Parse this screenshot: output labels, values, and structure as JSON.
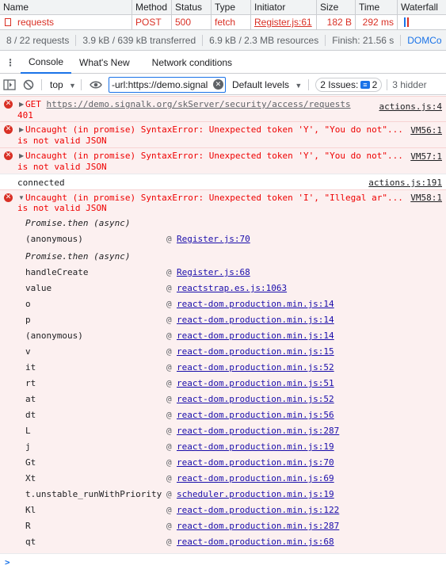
{
  "network": {
    "headers": [
      "Name",
      "Method",
      "Status",
      "Type",
      "Initiator",
      "Size",
      "Time",
      "Waterfall"
    ],
    "row": {
      "name": "requests",
      "method": "POST",
      "status": "500",
      "type": "fetch",
      "initiator": "Register.js:61",
      "size": "182 B",
      "time": "292 ms"
    },
    "summary": {
      "requests": "8 / 22 requests",
      "transferred": "3.9 kB / 639 kB transferred",
      "resources": "6.9 kB / 2.3 MB resources",
      "finish": "Finish: 21.56 s",
      "domcontent": "DOMCo"
    }
  },
  "drawer": {
    "tabs": [
      "Console",
      "What's New",
      "Network conditions"
    ],
    "active_tab": "Console"
  },
  "toolbar": {
    "context": "top",
    "filter_value": "-url:https://demo.signal",
    "levels": "Default levels",
    "issues_label": "2 Issues:",
    "issues_count": "2",
    "hidden": "3 hidder"
  },
  "console": {
    "msg1": {
      "method": "GET",
      "url": "https://demo.signalk.org/skServer/security/access/requests",
      "status": "401",
      "source": "actions.js:4"
    },
    "msg2": {
      "line1": "Uncaught (in promise) SyntaxError: Unexpected token 'Y', \"You do not\"...",
      "line2": "is not valid JSON",
      "source": "VM56:1"
    },
    "msg3": {
      "line1": "Uncaught (in promise) SyntaxError: Unexpected token 'Y', \"You do not\"...",
      "line2": "is not valid JSON",
      "source": "VM57:1"
    },
    "msg4": {
      "text": "connected",
      "source": "actions.js:191"
    },
    "msg5": {
      "line1": "Uncaught (in promise) SyntaxError: Unexpected token 'I', \"Illegal ar\"...",
      "line2": "is not valid JSON",
      "source": "VM58:1",
      "async1": "Promise.then (async)",
      "async2": "Promise.then (async)",
      "at": "@",
      "stack": [
        {
          "fn": "(anonymous)",
          "link": "Register.js:70"
        },
        {
          "fn": "handleCreate",
          "link": "Register.js:68"
        },
        {
          "fn": "value",
          "link": "reactstrap.es.js:1063"
        },
        {
          "fn": "o",
          "link": "react-dom.production.min.js:14"
        },
        {
          "fn": "p",
          "link": "react-dom.production.min.js:14"
        },
        {
          "fn": "(anonymous)",
          "link": "react-dom.production.min.js:14"
        },
        {
          "fn": "v",
          "link": "react-dom.production.min.js:15"
        },
        {
          "fn": "it",
          "link": "react-dom.production.min.js:52"
        },
        {
          "fn": "rt",
          "link": "react-dom.production.min.js:51"
        },
        {
          "fn": "at",
          "link": "react-dom.production.min.js:52"
        },
        {
          "fn": "dt",
          "link": "react-dom.production.min.js:56"
        },
        {
          "fn": "L",
          "link": "react-dom.production.min.js:287"
        },
        {
          "fn": "j",
          "link": "react-dom.production.min.js:19"
        },
        {
          "fn": "Gt",
          "link": "react-dom.production.min.js:70"
        },
        {
          "fn": "Xt",
          "link": "react-dom.production.min.js:69"
        },
        {
          "fn": "t.unstable_runWithPriority",
          "link": "scheduler.production.min.js:19"
        },
        {
          "fn": "Kl",
          "link": "react-dom.production.min.js:122"
        },
        {
          "fn": "R",
          "link": "react-dom.production.min.js:287"
        },
        {
          "fn": "qt",
          "link": "react-dom.production.min.js:68"
        }
      ]
    }
  },
  "prompt_symbol": ">"
}
